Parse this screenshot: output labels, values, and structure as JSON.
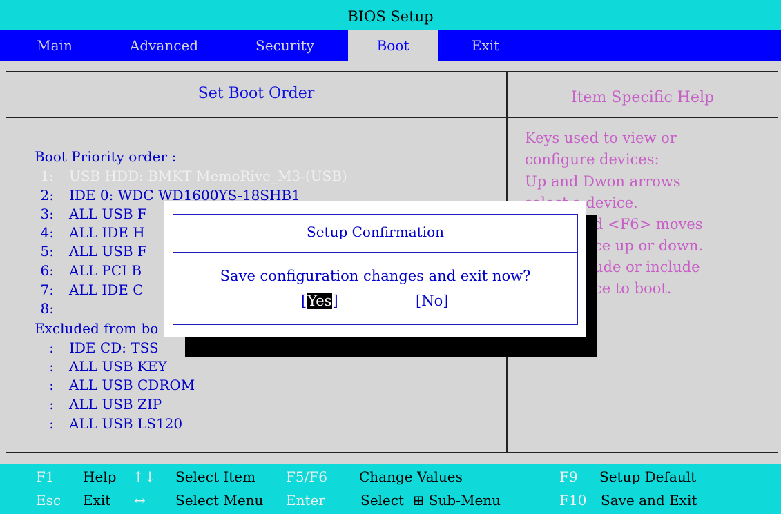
{
  "window": {
    "title": "BIOS Setup"
  },
  "menu": {
    "items": [
      {
        "label": "Main"
      },
      {
        "label": "Advanced"
      },
      {
        "label": "Security"
      },
      {
        "label": "Boot",
        "active": true
      },
      {
        "label": "Exit"
      }
    ]
  },
  "main_panel": {
    "title": "Set Boot Order",
    "priority_heading": "Boot Priority order :",
    "priority_items": [
      {
        "num": "1:",
        "device": "USB HDD: BMKT MemoRive_M3-(USB)",
        "selected": true
      },
      {
        "num": "2:",
        "device": "IDE 0: WDC WD1600YS-18SHB1"
      },
      {
        "num": "3:",
        "device": "ALL USB F"
      },
      {
        "num": "4:",
        "device": "ALL IDE H"
      },
      {
        "num": "5:",
        "device": "ALL USB F"
      },
      {
        "num": "6:",
        "device": "ALL PCI B"
      },
      {
        "num": "7:",
        "device": "ALL IDE C"
      },
      {
        "num": "8:",
        "device": ""
      }
    ],
    "excluded_heading": "Excluded from bo",
    "excluded_items": [
      {
        "num": ":",
        "device": "IDE CD: TSS"
      },
      {
        "num": ":",
        "device": "ALL USB KEY"
      },
      {
        "num": ":",
        "device": "ALL USB CDROM"
      },
      {
        "num": ":",
        "device": "ALL USB ZIP"
      },
      {
        "num": ":",
        "device": "ALL USB LS120"
      }
    ]
  },
  "help_panel": {
    "title": "Item Specific Help",
    "lines": [
      "Keys used to view or",
      "configure devices:",
      "Up and Dwon arrows",
      "select a device.",
      "d <F6> moves",
      "ce up or down.",
      "ude or include",
      "ce to boot."
    ]
  },
  "dialog": {
    "title": "Setup Confirmation",
    "message": "Save configuration changes and exit now?",
    "yes_open": "[",
    "yes_label": "Yes",
    "yes_close": "]",
    "no_label": "[No]"
  },
  "footer": {
    "row1": [
      {
        "key": "F1",
        "desc": "Help"
      },
      {
        "key": "↑↓",
        "desc": "Select Item"
      },
      {
        "key": "F5/F6",
        "desc": "Change Values"
      },
      {
        "key": "F9",
        "desc": "Setup Default"
      }
    ],
    "row2": [
      {
        "key": "Esc",
        "desc": "Exit"
      },
      {
        "key": "↔",
        "desc": "Select Menu"
      },
      {
        "key": "Enter",
        "desc": "Select  ⊞ Sub-Menu"
      },
      {
        "key": "F10",
        "desc": "Save and Exit"
      }
    ]
  },
  "colors": {
    "title_bar": "#0fd9d9",
    "menu_bar": "#0000fe",
    "background": "#d6d6d6",
    "text_blue": "#0000c8",
    "help_text": "#c75fc7"
  }
}
